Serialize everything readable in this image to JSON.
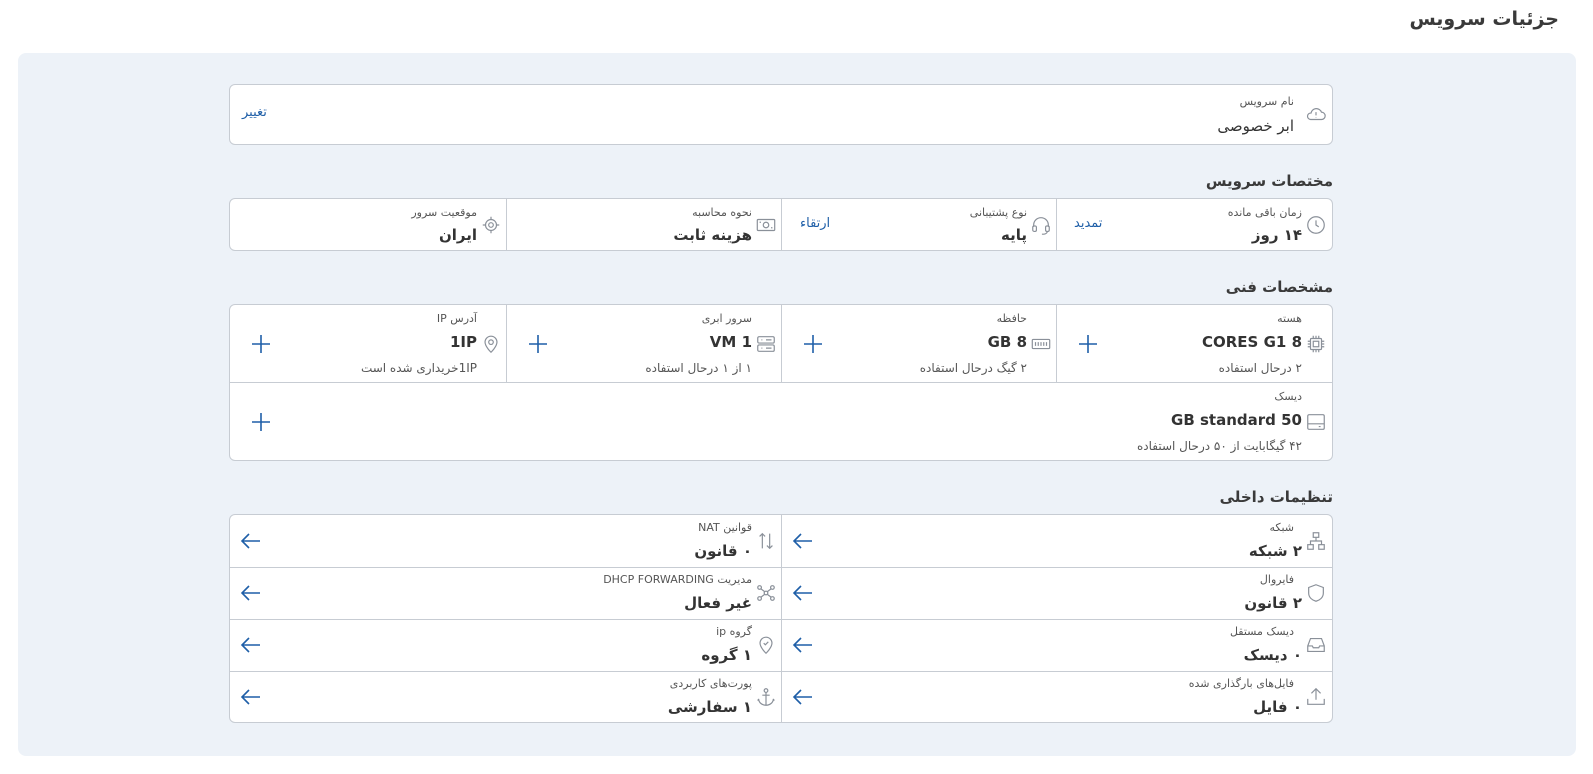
{
  "page": {
    "title": "جزئیات سرویس"
  },
  "service": {
    "name_label": "نام سرویس",
    "name_value": "ابر خصوصی",
    "change_label": "تغییر"
  },
  "specs": {
    "title": "مختصات سرویس",
    "remaining": {
      "label": "زمان باقی مانده",
      "value": "۱۴ روز",
      "action": "تمدید"
    },
    "support": {
      "label": "نوع پشتیبانی",
      "value": "پایه",
      "action": "ارتقاء"
    },
    "billing": {
      "label": "نحوه محاسبه",
      "value": "هزینه ثابت"
    },
    "location": {
      "label": "موقعیت سرور",
      "value": "ایران"
    }
  },
  "tech": {
    "title": "مشخصات فنی",
    "cores": {
      "label": "هسته",
      "value": "8 CORES G1",
      "sub": "۲ درحال استفاده"
    },
    "memory": {
      "label": "حافظه",
      "value": "8 GB",
      "sub": "۲ گیگ درحال استفاده"
    },
    "vm": {
      "label": "سرور ابری",
      "value": "1 VM",
      "sub": "۱ از ۱ درحال استفاده"
    },
    "ip": {
      "label": "آدرس IP",
      "value": "1IP",
      "sub": "1IPخریداری شده است"
    },
    "disk": {
      "label": "دیسک",
      "value": "50 GB standard",
      "sub": "۴۲ گیگابایت از ۵۰ درحال استفاده"
    }
  },
  "internal": {
    "title": "تنظیمات داخلی",
    "network": {
      "label": "شبکه",
      "value": "۲ شبکه"
    },
    "nat": {
      "label": "قوانین NAT",
      "value": "۰ قانون"
    },
    "firewall": {
      "label": "فایروال",
      "value": "۲ قانون"
    },
    "dhcp": {
      "label": "مدیریت DHCP FORWARDING",
      "value": "غیر فعال"
    },
    "independent_disk": {
      "label": "دیسک مستقل",
      "value": "۰ دیسک"
    },
    "ip_group": {
      "label": "گروه ip",
      "value": "۱ گروه"
    },
    "uploaded_files": {
      "label": "فایل‌های بارگذاری شده",
      "value": "۰ فایل"
    },
    "user_ports": {
      "label": "پورت‌های کاربردی",
      "value": "۱ سفارشی"
    }
  },
  "colors": {
    "accent": "#1f5fa8",
    "panel": "#edf2f8",
    "border": "#c7ccd3"
  }
}
